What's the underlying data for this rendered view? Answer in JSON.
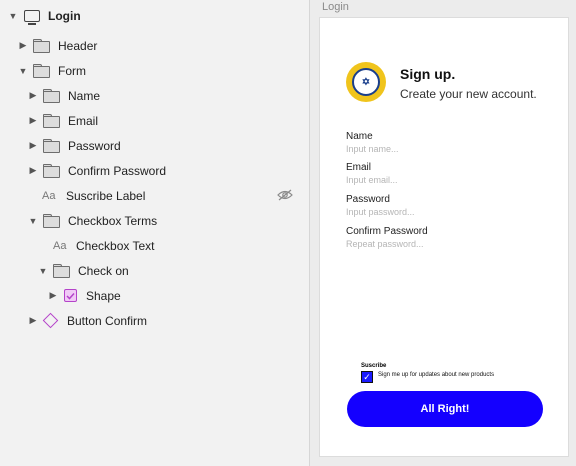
{
  "layers": {
    "root": {
      "label": "Login"
    },
    "items": [
      {
        "label": "Header"
      },
      {
        "label": "Form"
      },
      {
        "label": "Name"
      },
      {
        "label": "Email"
      },
      {
        "label": "Password"
      },
      {
        "label": "Confirm Password"
      },
      {
        "label": "Suscribe Label",
        "icon_text": "Aa"
      },
      {
        "label": "Checkbox Terms"
      },
      {
        "label": "Checkbox Text",
        "icon_text": "Aa"
      },
      {
        "label": "Check on"
      },
      {
        "label": "Shape"
      },
      {
        "label": "Button Confirm"
      }
    ]
  },
  "artboard": {
    "title": "Login",
    "heading": "Sign up.",
    "subheading": "Create your new account.",
    "fields": [
      {
        "label": "Name",
        "placeholder": "Input name..."
      },
      {
        "label": "Email",
        "placeholder": "Input email..."
      },
      {
        "label": "Password",
        "placeholder": "Input password..."
      },
      {
        "label": "Confirm Password",
        "placeholder": "Repeat password..."
      }
    ],
    "subscribe_label": "Suscribe",
    "checkbox_text": "Sign me up for updates about new products",
    "checkbox_checked": true,
    "button_label": "All Right!",
    "accent_color": "#1400ff"
  }
}
